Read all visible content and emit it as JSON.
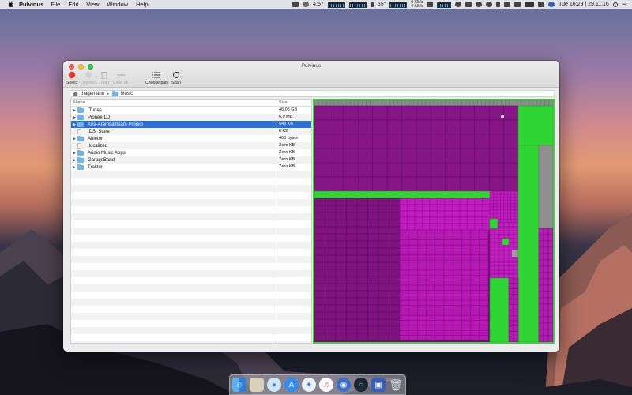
{
  "menubar": {
    "app_name": "Pulvinus",
    "menus": [
      "File",
      "Edit",
      "View",
      "Window",
      "Help"
    ],
    "timer": "4:57",
    "temp": "55°",
    "net_up": "0 KB/s",
    "net_down": "0 KB/s",
    "clock": "Tue 16:29 | 29.11.16"
  },
  "window": {
    "title": "Pulvinus",
    "toolbar": {
      "select": "Select",
      "deselect": "Deselect",
      "trash": "Trash",
      "clear_all": "Clear all",
      "choose_path": "Choose path",
      "scan": "Scan"
    },
    "path": {
      "root": "thagemann",
      "folder": "Music"
    },
    "table": {
      "col_name": "Name",
      "col_size": "Size",
      "rows": [
        {
          "name": "iTunes",
          "size": "46,05 GB",
          "type": "folder",
          "expandable": true,
          "selected": false
        },
        {
          "name": "PioneerDJ",
          "size": "6,9 MB",
          "type": "folder",
          "expandable": true,
          "selected": false
        },
        {
          "name": "Kira-Aramsamsam Project",
          "size": "543 KB",
          "type": "folder",
          "expandable": true,
          "selected": true
        },
        {
          "name": ".DS_Store",
          "size": "6 KB",
          "type": "file",
          "expandable": false,
          "selected": false
        },
        {
          "name": "Ableton",
          "size": "463 bytes",
          "type": "folder",
          "expandable": true,
          "selected": false
        },
        {
          "name": ".localized",
          "size": "Zero KB",
          "type": "file",
          "expandable": false,
          "selected": false
        },
        {
          "name": "Audio Music Apps",
          "size": "Zero KB",
          "type": "folder",
          "expandable": true,
          "selected": false
        },
        {
          "name": "GarageBand",
          "size": "Zero KB",
          "type": "folder",
          "expandable": true,
          "selected": false
        },
        {
          "name": "Traktor",
          "size": "Zero KB",
          "type": "folder",
          "expandable": true,
          "selected": false
        }
      ]
    },
    "treemap_colors": {
      "purple": "#8a1688",
      "magenta": "#c21cc0",
      "green": "#2fd633",
      "gray": "#8a8a8a"
    }
  },
  "dock": {
    "items": [
      "finder-icon",
      "preview-icon",
      "messages-icon",
      "appstore-icon",
      "safari-icon",
      "itunes-icon",
      "launchpad-icon",
      "steam-icon",
      "pulvinus-icon",
      "trash-icon"
    ]
  }
}
